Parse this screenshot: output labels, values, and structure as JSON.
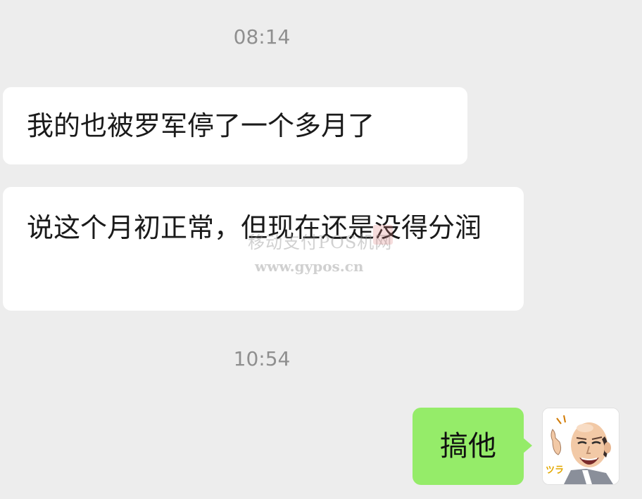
{
  "timestamps": {
    "first": "08:14",
    "second": "10:54"
  },
  "messages": {
    "received_1": "我的也被罗军停了一个多月了",
    "received_2": "说这个月初正常，但现在还是没得分润",
    "sent_1": "搞他"
  },
  "watermark": {
    "line1": "移动支付POS机网",
    "line2": "www.gypos.cn"
  },
  "avatar": {
    "icon": "cartoon-man-avatar-icon",
    "caption": "ツラ"
  },
  "colors": {
    "background": "#ededed",
    "received_bubble": "#ffffff",
    "sent_bubble": "#95ec69",
    "timestamp_text": "#8f8f8f"
  }
}
